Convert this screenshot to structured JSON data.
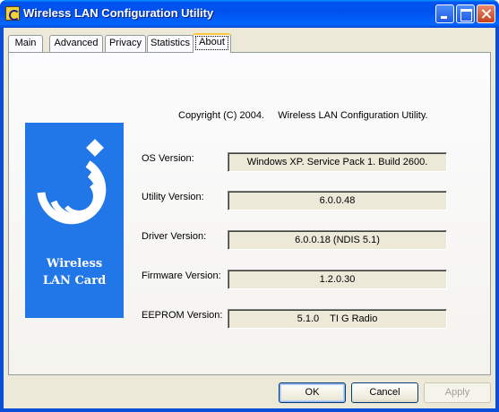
{
  "window": {
    "title": "Wireless LAN Configuration Utility"
  },
  "tabs": [
    {
      "label": "Main"
    },
    {
      "label": "Advanced"
    },
    {
      "label": "Privacy"
    },
    {
      "label": "Statistics"
    },
    {
      "label": "About",
      "active": true
    }
  ],
  "about": {
    "copyright": "Copyright (C) 2004.     Wireless LAN Configuration Utility.",
    "logo": {
      "line1": "Wireless",
      "line2": "LAN Card",
      "color": "#2176e8"
    },
    "rows": [
      {
        "label": "OS Version:",
        "value": "Windows XP. Service Pack 1. Build 2600."
      },
      {
        "label": "Utility Version:",
        "value": "6.0.0.48"
      },
      {
        "label": "Driver Version:",
        "value": "6.0.0.18 (NDIS 5.1)"
      },
      {
        "label": "Firmware Version:",
        "value": "1.2.0.30"
      },
      {
        "label": "EEPROM Version:",
        "value": "5.1.0    TI G Radio"
      }
    ]
  },
  "buttons": {
    "ok": "OK",
    "cancel": "Cancel",
    "apply": "Apply"
  }
}
